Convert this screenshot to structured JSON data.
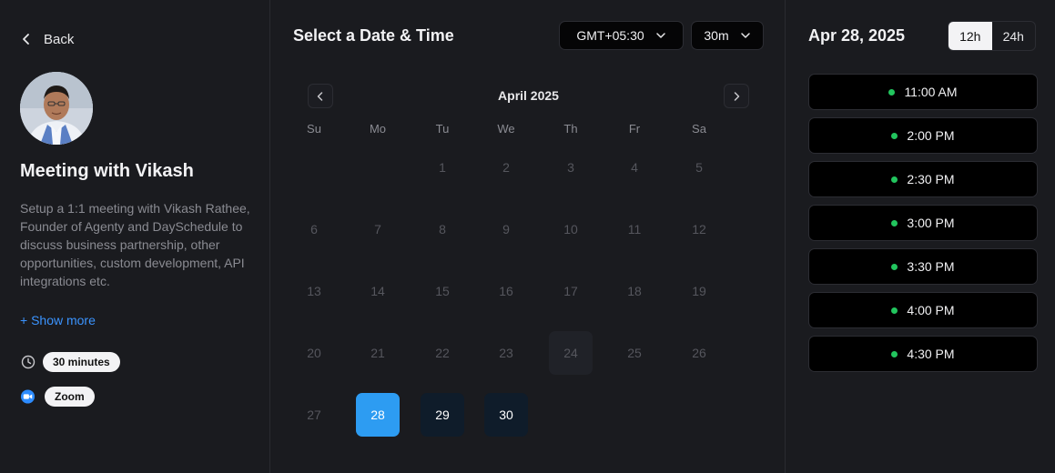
{
  "left": {
    "back_label": "Back",
    "title": "Meeting with Vikash",
    "description": "Setup a 1:1 meeting with Vikash Rathee, Founder of Agenty and DaySchedule to discuss business partnership, other opportunities, custom development, API integrations etc.",
    "show_more": "+ Show more",
    "duration_icon": "clock-icon",
    "duration": "30 minutes",
    "location_icon": "zoom-icon",
    "location": "Zoom"
  },
  "middle": {
    "title": "Select a Date & Time",
    "timezone": "GMT+05:30",
    "duration_select": "30m",
    "month": "April 2025",
    "weekdays": [
      "Su",
      "Mo",
      "Tu",
      "We",
      "Th",
      "Fr",
      "Sa"
    ],
    "days": [
      {
        "label": "1",
        "state": "disabled"
      },
      {
        "label": "2",
        "state": "disabled"
      },
      {
        "label": "3",
        "state": "disabled"
      },
      {
        "label": "4",
        "state": "disabled"
      },
      {
        "label": "5",
        "state": "disabled"
      },
      {
        "label": "6",
        "state": "disabled"
      },
      {
        "label": "7",
        "state": "disabled"
      },
      {
        "label": "8",
        "state": "disabled"
      },
      {
        "label": "9",
        "state": "disabled"
      },
      {
        "label": "10",
        "state": "disabled"
      },
      {
        "label": "11",
        "state": "disabled"
      },
      {
        "label": "12",
        "state": "disabled"
      },
      {
        "label": "13",
        "state": "disabled"
      },
      {
        "label": "14",
        "state": "disabled"
      },
      {
        "label": "15",
        "state": "disabled"
      },
      {
        "label": "16",
        "state": "disabled"
      },
      {
        "label": "17",
        "state": "disabled"
      },
      {
        "label": "18",
        "state": "disabled"
      },
      {
        "label": "19",
        "state": "disabled"
      },
      {
        "label": "20",
        "state": "disabled"
      },
      {
        "label": "21",
        "state": "disabled"
      },
      {
        "label": "22",
        "state": "disabled"
      },
      {
        "label": "23",
        "state": "disabled"
      },
      {
        "label": "24",
        "state": "today"
      },
      {
        "label": "25",
        "state": "disabled"
      },
      {
        "label": "26",
        "state": "disabled"
      },
      {
        "label": "27",
        "state": "disabled"
      },
      {
        "label": "28",
        "state": "selected"
      },
      {
        "label": "29",
        "state": "available"
      },
      {
        "label": "30",
        "state": "available"
      }
    ]
  },
  "right": {
    "date": "Apr 28, 2025",
    "format_12h": "12h",
    "format_24h": "24h",
    "active_format": "12h",
    "slots": [
      "11:00 AM",
      "2:00 PM",
      "2:30 PM",
      "3:00 PM",
      "3:30 PM",
      "4:00 PM",
      "4:30 PM"
    ]
  },
  "colors": {
    "background": "#1a1b1f",
    "selected_day": "#2d9cf2",
    "available_day": "#0f1c2a",
    "slot_dot": "#22c55e",
    "link": "#3b94ff"
  }
}
